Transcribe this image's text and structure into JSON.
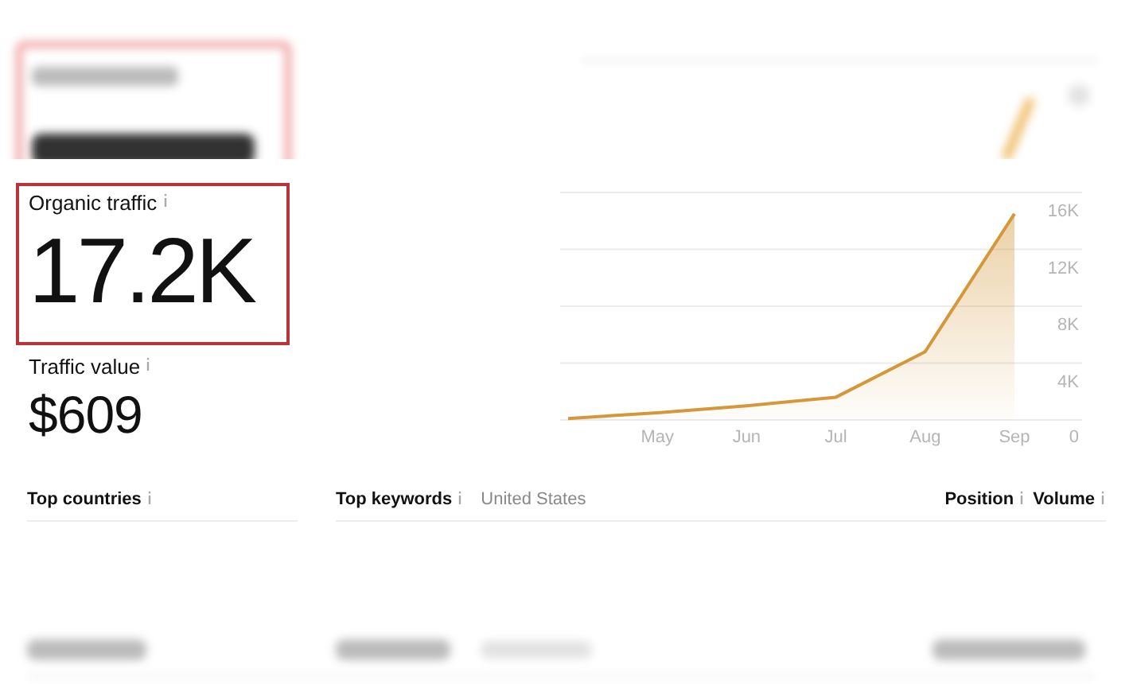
{
  "metrics": [
    {
      "label": "Organic traffic",
      "value": "17.2K",
      "highlighted": true
    },
    {
      "label": "Traffic value",
      "value": "$609",
      "highlighted": false
    }
  ],
  "traffic_chart": {
    "chart_data": {
      "type": "area",
      "grid": true,
      "categories": [
        null,
        "May",
        "Jun",
        "Jul",
        "Aug",
        "Sep"
      ],
      "series": [
        {
          "color": "#d4973a",
          "values": [
            100,
            500,
            1000,
            1600,
            4800,
            14500
          ]
        }
      ],
      "ylim": [
        0,
        16000
      ],
      "yticks": [
        0,
        {
          "value": 4000,
          "label": "4K"
        },
        {
          "value": 8000,
          "label": "8K"
        },
        {
          "value": 12000,
          "label": "12K"
        },
        {
          "value": 16000,
          "label": "16K"
        }
      ]
    }
  },
  "top_countries": {
    "title": "Top countries"
  },
  "top_keywords": {
    "title": "Top keywords",
    "location": "United States",
    "columns": [
      "Position",
      "Volume"
    ]
  }
}
